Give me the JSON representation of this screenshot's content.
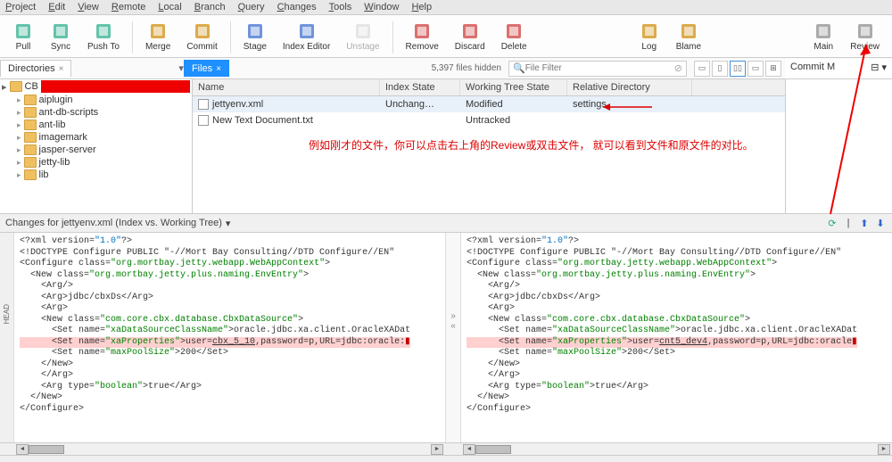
{
  "menus": [
    "Project",
    "Edit",
    "View",
    "Remote",
    "Local",
    "Branch",
    "Query",
    "Changes",
    "Tools",
    "Window",
    "Help"
  ],
  "toolbar": [
    {
      "label": "Pull",
      "icon": "pull"
    },
    {
      "label": "Sync",
      "icon": "sync"
    },
    {
      "label": "Push To",
      "icon": "push"
    },
    "sep",
    {
      "label": "Merge",
      "icon": "merge"
    },
    {
      "label": "Commit",
      "icon": "commit"
    },
    "sep",
    {
      "label": "Stage",
      "icon": "stage"
    },
    {
      "label": "Index Editor",
      "icon": "idxed"
    },
    {
      "label": "Unstage",
      "icon": "unstage",
      "disabled": true
    },
    "sep",
    {
      "label": "Remove",
      "icon": "remove"
    },
    {
      "label": "Discard",
      "icon": "discard"
    },
    {
      "label": "Delete",
      "icon": "delete"
    },
    "spacer",
    {
      "label": "Log",
      "icon": "log"
    },
    {
      "label": "Blame",
      "icon": "blame"
    },
    "spacer2",
    {
      "label": "Main",
      "icon": "main"
    },
    {
      "label": "Review",
      "icon": "review"
    }
  ],
  "tabs": {
    "dir": "Directories",
    "files": "Files"
  },
  "filter_hidden": "5,397 files hidden",
  "filter_placeholder": "File Filter",
  "commit_panel": "Commit M",
  "tree": {
    "root": "CB",
    "children": [
      "aiplugin",
      "ant-db-scripts",
      "ant-lib",
      "imagemark",
      "jasper-server",
      "jetty-lib",
      "lib"
    ]
  },
  "file_cols": [
    "Name",
    "Index State",
    "Working Tree State",
    "Relative Directory"
  ],
  "files": [
    {
      "name": "jettyenv.xml",
      "idx": "Unchang…",
      "wt": "Modified",
      "rd": "settings",
      "sel": true
    },
    {
      "name": "New Text Document.txt",
      "idx": "",
      "wt": "Untracked",
      "rd": ""
    }
  ],
  "annotation": "例如刚才的文件，你可以点击右上角的Review或双击文件，\n就可以看到文件和原文件的对比。",
  "diff_title": "Changes for jettyenv.xml (Index vs. Working Tree)",
  "diff": {
    "left": [
      {
        "t": "<?xml version=",
        "c": ""
      },
      {
        "t": "\"1.0\"",
        "c": "blue"
      },
      {
        "t": "?>"
      },
      "\n",
      {
        "t": "<!DOCTYPE Configure PUBLIC \"-//Mort Bay Consulting//DTD Configure//EN\""
      },
      "\n",
      {
        "t": "<Configure class="
      },
      {
        "t": "\"org.mortbay.jetty.webapp.WebAppContext\"",
        "c": "green"
      },
      {
        "t": ">"
      },
      "\n",
      {
        "t": "  <New class="
      },
      {
        "t": "\"org.mortbay.jetty.plus.naming.EnvEntry\"",
        "c": "green"
      },
      {
        "t": ">"
      },
      "\n",
      {
        "t": "    <Arg/>"
      },
      "\n",
      {
        "t": "    <Arg>jdbc/cbxDs</Arg>"
      },
      "\n",
      {
        "t": "    <Arg>"
      },
      "\n",
      {
        "t": "    <New class="
      },
      {
        "t": "\"com.core.cbx.database.CbxDataSource\"",
        "c": "green"
      },
      {
        "t": ">"
      },
      "\n",
      {
        "t": "      <Set name="
      },
      {
        "t": "\"xaDataSourceClassName\"",
        "c": "green"
      },
      {
        "t": ">oracle.jdbc.xa.client.OracleXADat"
      },
      "\n",
      {
        "t": "      <Set name=",
        "hl": true
      },
      {
        "t": "\"xaProperties\"",
        "c": "green",
        "hl": true
      },
      {
        "t": ">user=",
        "hl": true
      },
      {
        "t": "cbx_5_10",
        "hl": true,
        "u": true
      },
      {
        "t": ",password=p,URL=jdbc:oracle:",
        "hl": true
      },
      {
        "t": "▮",
        "c": "red",
        "hl": true
      },
      "\n",
      {
        "t": "      <Set name="
      },
      {
        "t": "\"maxPoolSize\"",
        "c": "green"
      },
      {
        "t": ">200</Set>"
      },
      "\n",
      {
        "t": "    </New>"
      },
      "\n",
      {
        "t": "    </Arg>"
      },
      "\n",
      {
        "t": "    <Arg type="
      },
      {
        "t": "\"boolean\"",
        "c": "green"
      },
      {
        "t": ">true</Arg>"
      },
      "\n",
      {
        "t": "  </New>"
      },
      "\n",
      {
        "t": "</Configure>"
      }
    ],
    "right": [
      {
        "t": "<?xml version=",
        "c": ""
      },
      {
        "t": "\"1.0\"",
        "c": "blue"
      },
      {
        "t": "?>"
      },
      "\n",
      {
        "t": "<!DOCTYPE Configure PUBLIC \"-//Mort Bay Consulting//DTD Configure//EN\""
      },
      "\n",
      {
        "t": "<Configure class="
      },
      {
        "t": "\"org.mortbay.jetty.webapp.WebAppContext\"",
        "c": "green"
      },
      {
        "t": ">"
      },
      "\n",
      {
        "t": "  <New class="
      },
      {
        "t": "\"org.mortbay.jetty.plus.naming.EnvEntry\"",
        "c": "green"
      },
      {
        "t": ">"
      },
      "\n",
      {
        "t": "    <Arg/>"
      },
      "\n",
      {
        "t": "    <Arg>jdbc/cbxDs</Arg>"
      },
      "\n",
      {
        "t": "    <Arg>"
      },
      "\n",
      {
        "t": "    <New class="
      },
      {
        "t": "\"com.core.cbx.database.CbxDataSource\"",
        "c": "green"
      },
      {
        "t": ">"
      },
      "\n",
      {
        "t": "      <Set name="
      },
      {
        "t": "\"xaDataSourceClassName\"",
        "c": "green"
      },
      {
        "t": ">oracle.jdbc.xa.client.OracleXADat"
      },
      "\n",
      {
        "t": "      <Set name=",
        "hl": true
      },
      {
        "t": "\"xaProperties\"",
        "c": "green",
        "hl": true
      },
      {
        "t": ">user=",
        "hl": true
      },
      {
        "t": "cnt5_dev4",
        "hl": true,
        "u": true
      },
      {
        "t": ",password=p,URL=jdbc:oracle",
        "hl": true
      },
      {
        "t": "▮",
        "c": "red",
        "hl": true
      },
      "\n",
      {
        "t": "      <Set name="
      },
      {
        "t": "\"maxPoolSize\"",
        "c": "green"
      },
      {
        "t": ">200</Set>"
      },
      "\n",
      {
        "t": "    </New>"
      },
      "\n",
      {
        "t": "    </Arg>"
      },
      "\n",
      {
        "t": "    <Arg type="
      },
      {
        "t": "\"boolean\"",
        "c": "green"
      },
      {
        "t": ">true</Arg>"
      },
      "\n",
      {
        "t": "  </New>"
      },
      "\n",
      {
        "t": "</Configure>"
      }
    ]
  }
}
